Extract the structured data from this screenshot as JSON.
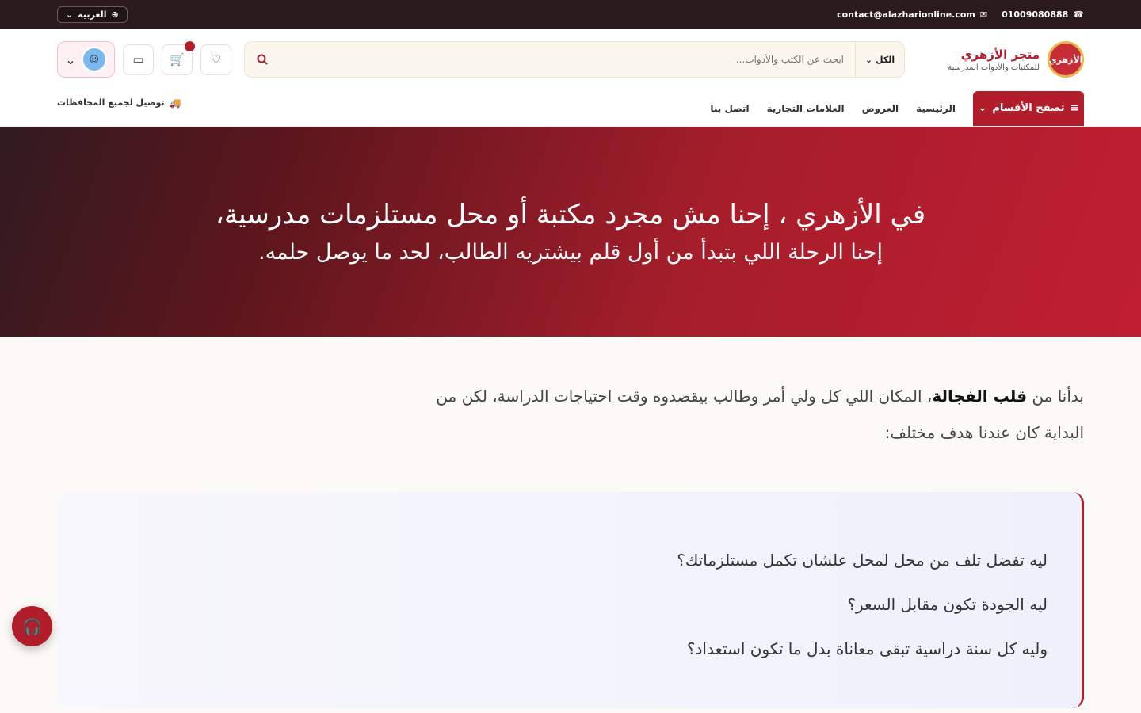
{
  "topbar": {
    "phone": "01009080888",
    "email": "contact@alazharionline.com",
    "language": "العربية"
  },
  "header": {
    "logo_mark": "الأزهري",
    "logo_title": "متجر الأزهري",
    "logo_subtitle": "للمكتبات والأدوات المدرسية",
    "search_category": "الكل",
    "search_placeholder": "ابحث عن الكتب والأدوات...",
    "cart_badge": ""
  },
  "nav": {
    "browse": "تصفح الأقسام",
    "links": [
      "الرئيسية",
      "العروض",
      "العلامات التجارية",
      "اتصل بنا"
    ],
    "delivery": "توصيل لجميع المحافظات"
  },
  "hero": {
    "title": "في الأزهري ، إحنا مش مجرد مكتبة أو محل مستلزمات مدرسية،",
    "subtitle": "إحنا الرحلة اللي بتبدأ من أول قلم بيشتريه الطالب، لحد ما يوصل حلمه."
  },
  "intro": {
    "prefix": "بدأنا من ",
    "emphasis": "قلب الفجالة",
    "suffix": "، المكان اللي كل ولي أمر وطالب بيقصدوه وقت احتياجات الدراسة، لكن من البداية كان عندنا هدف مختلف:"
  },
  "questions": [
    "ليه تفضل تلف من محل لمحل علشان تكمل مستلزماتك؟",
    "ليه الجودة تكون مقابل السعر؟",
    "وليه كل سنة دراسية تبقى معاناة بدل ما تكون استعداد؟"
  ],
  "icons": {
    "phone": "phone-icon",
    "email": "mail-icon",
    "globe": "globe-icon",
    "search": "search-icon",
    "wishlist": "heart-icon",
    "cart": "cart-icon",
    "compare": "ticket-icon",
    "profile": "avatar",
    "delivery": "truck-icon",
    "support": "headset-icon"
  },
  "colors": {
    "brand": "#b11d2a",
    "topbar": "#2b1a1d",
    "hero_start": "#301b20",
    "hero_end": "#c01f31"
  }
}
